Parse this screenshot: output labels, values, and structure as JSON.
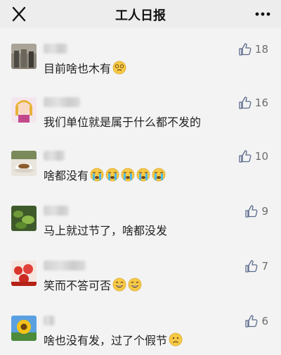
{
  "header": {
    "title": "工人日报"
  },
  "comments": [
    {
      "text": "目前啥也木有",
      "likes": "18",
      "emoji": [
        "dizzy-face-emoji"
      ]
    },
    {
      "text": "我们单位就是属于什么都不发的",
      "likes": "16",
      "emoji": []
    },
    {
      "text": "啥都没有",
      "likes": "10",
      "emoji": [
        "crying-face-emoji",
        "crying-face-emoji",
        "crying-face-emoji",
        "crying-face-emoji",
        "crying-face-emoji"
      ]
    },
    {
      "text": "马上就过节了，啥都没发",
      "likes": "9",
      "emoji": []
    },
    {
      "text": "笑而不答可否",
      "likes": "7",
      "emoji": [
        "grinning-face-emoji",
        "grinning-face-emoji"
      ]
    },
    {
      "text": "啥也没有发，过了个假节",
      "likes": "6",
      "emoji": [
        "frowning-face-emoji"
      ]
    }
  ],
  "colors": {
    "background": "#f3f3f3",
    "like_icon": "#5a6b8c"
  }
}
